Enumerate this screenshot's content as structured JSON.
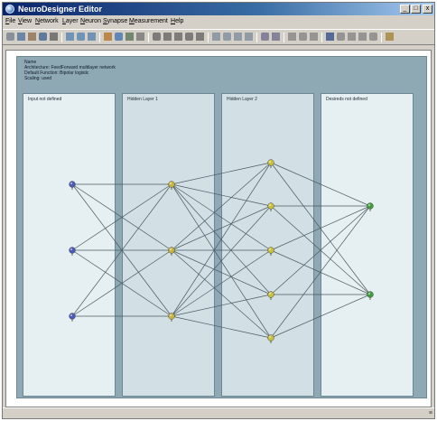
{
  "window": {
    "title": "NeuroDesigner Editor"
  },
  "title_buttons": {
    "minimize": "_",
    "maximize": "□",
    "close": "x"
  },
  "menus": [
    "File",
    "View",
    "Network",
    "Layer",
    "Neuron",
    "Synapse",
    "Measurement",
    "Help"
  ],
  "toolbar_icons": [
    "new-icon",
    "open-icon",
    "close-file-icon",
    "save-icon",
    "print-icon",
    "zoom-in-icon",
    "zoom-out-icon",
    "zoom-fit-icon",
    "draw-tool-icon",
    "select-tool-icon",
    "link-tool-icon",
    "grid-icon",
    "first-icon",
    "prev-icon",
    "step-back-icon",
    "play-icon",
    "last-icon",
    "chart-icon",
    "histogram-icon",
    "graph-icon",
    "table-icon",
    "eye-icon",
    "eye-alt-icon",
    "forward-icon",
    "backward-icon",
    "cycle-icon",
    "monitor-icon",
    "add-icon",
    "remove-icon",
    "list-icon",
    "config-icon",
    "help-icon"
  ],
  "network_info": [
    "Name",
    "Architecture: FeedForward multilayer network",
    "Default Function: Bipolar logistic",
    "Scaling: used"
  ],
  "layers": [
    {
      "label": "Input not defined",
      "neurons": 3,
      "neuron_color": "#4a5ab8"
    },
    {
      "label": "Hidden Layer 1",
      "neurons": 3,
      "neuron_color": "#c8b43a"
    },
    {
      "label": "Hidden Layer 2",
      "neurons": 5,
      "neuron_color": "#c8bf3a"
    },
    {
      "label": "Desireds not defined",
      "neurons": 2,
      "neuron_color": "#3f9e3a"
    }
  ],
  "status": {
    "corner": "≡"
  },
  "colors": {
    "pane": "#8fa9b4",
    "synapse": "#4a5a5f"
  }
}
